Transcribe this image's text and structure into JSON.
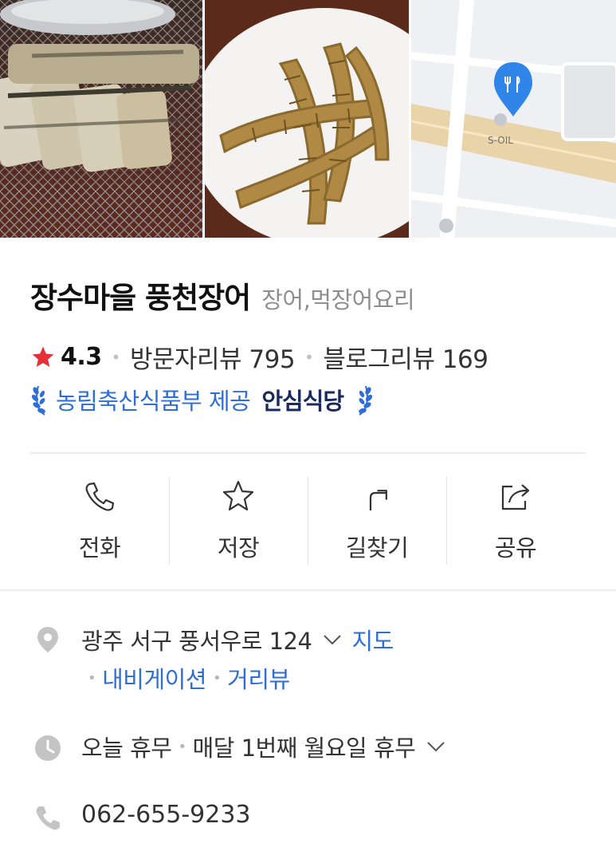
{
  "photos": [
    {
      "alt": "grilled eel on grill"
    },
    {
      "alt": "fried eel bones"
    },
    {
      "alt": "map thumbnail",
      "map_label": "S-OIL"
    }
  ],
  "place": {
    "name": "장수마을 풍천장어",
    "category": "장어,먹장어요리"
  },
  "rating": {
    "value": "4.3",
    "visitor_reviews_label": "방문자리뷰 795",
    "blog_reviews_label": "블로그리뷰 169"
  },
  "award": {
    "provider": "농림축산식품부 제공",
    "name": "안심식당"
  },
  "actions": [
    {
      "label": "전화",
      "icon": "phone-icon"
    },
    {
      "label": "저장",
      "icon": "star-outline-icon"
    },
    {
      "label": "길찾기",
      "icon": "directions-icon"
    },
    {
      "label": "공유",
      "icon": "share-icon"
    }
  ],
  "address": {
    "text": "광주 서구 풍서우로 124",
    "map_link": "지도",
    "navigation_link": "내비게이션",
    "streetview_link": "거리뷰"
  },
  "hours": {
    "today": "오늘 휴무",
    "detail": "매달 1번째 월요일 휴무"
  },
  "phone": "062-655-9233",
  "colors": {
    "accent_blue": "#2e6ed6",
    "star_red": "#e5303a",
    "map_pin_blue": "#2f86e8"
  }
}
